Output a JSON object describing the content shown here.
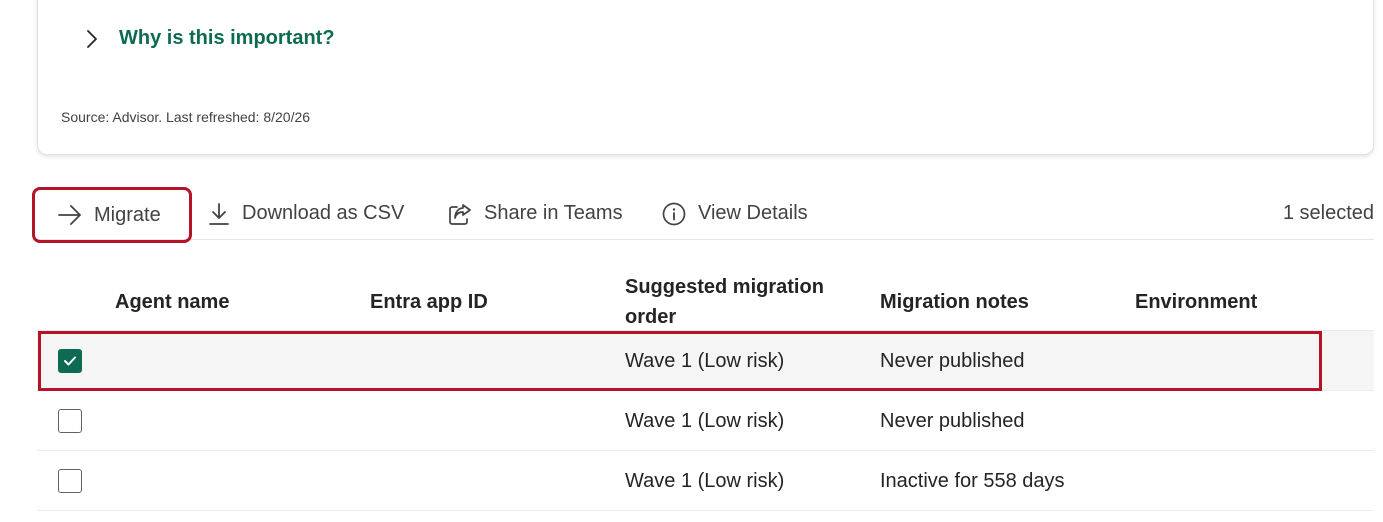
{
  "card": {
    "why_label": "Why is this important?",
    "source_text": "Source: Advisor. Last refreshed: 8/20/26"
  },
  "toolbar": {
    "migrate_label": "Migrate",
    "download_label": "Download as CSV",
    "share_label": "Share in Teams",
    "details_label": "View Details",
    "selected_count": "1 selected"
  },
  "table": {
    "headers": {
      "agent": "Agent name",
      "entra": "Entra app ID",
      "order": "Suggested migration order",
      "notes": "Migration notes",
      "env": "Environment"
    },
    "rows": [
      {
        "checked": true,
        "order": "Wave 1 (Low risk)",
        "notes": "Never published"
      },
      {
        "checked": false,
        "order": "Wave 1 (Low risk)",
        "notes": "Never published"
      },
      {
        "checked": false,
        "order": "Wave 1 (Low risk)",
        "notes": "Inactive for 558 days"
      }
    ]
  },
  "colors": {
    "accent": "#0e6a52",
    "highlight": "#b5132a"
  }
}
